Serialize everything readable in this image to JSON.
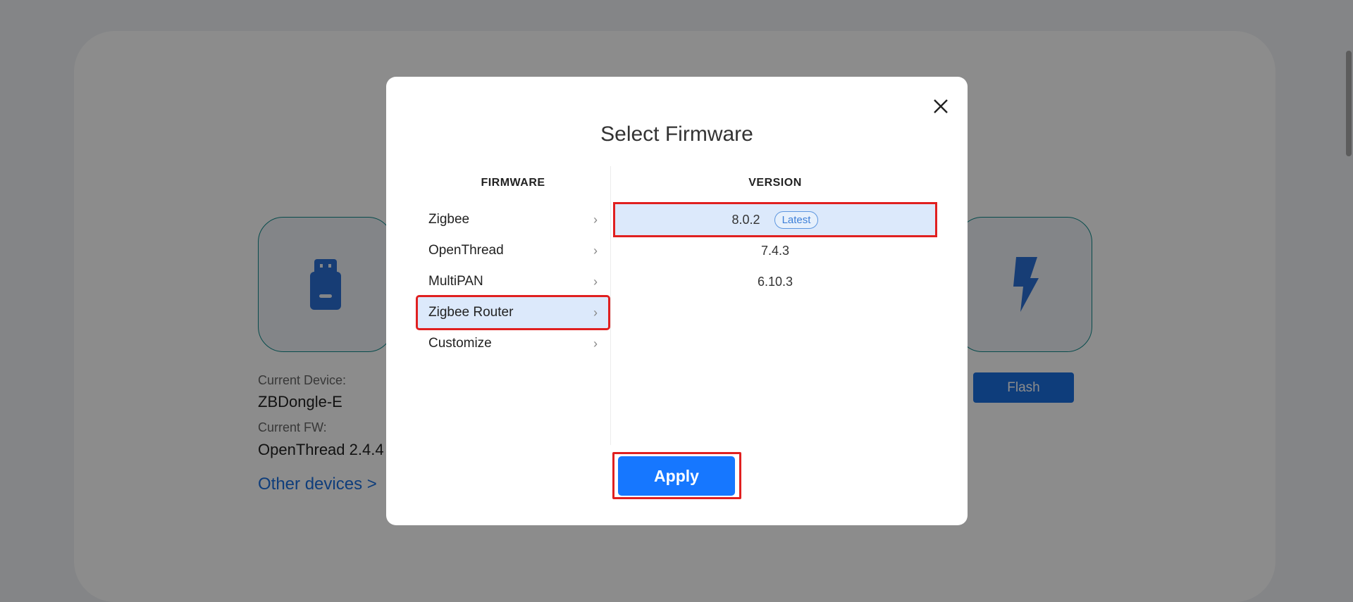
{
  "background": {
    "current_device_label": "Current Device:",
    "current_device_value": "ZBDongle-E",
    "current_fw_label": "Current FW:",
    "current_fw_value": "OpenThread 2.4.4",
    "other_devices_link": "Other devices >",
    "flash_button": "Flash"
  },
  "modal": {
    "title": "Select Firmware",
    "firmware_header": "FIRMWARE",
    "version_header": "VERSION",
    "firmware_items": [
      {
        "label": "Zigbee"
      },
      {
        "label": "OpenThread"
      },
      {
        "label": "MultiPAN"
      },
      {
        "label": "Zigbee Router"
      },
      {
        "label": "Customize"
      }
    ],
    "selected_firmware": "Zigbee Router",
    "versions": [
      {
        "label": "8.0.2",
        "badge": "Latest"
      },
      {
        "label": "7.4.3"
      },
      {
        "label": "6.10.3"
      }
    ],
    "selected_version": "8.0.2",
    "apply_button": "Apply"
  },
  "colors": {
    "accent": "#1677ff",
    "selection_bg": "#dce9fb",
    "highlight_outline": "#e02020",
    "teal_border": "#0d8a8a"
  },
  "icons": {
    "close": "close-icon",
    "chevron": "chevron-right-icon",
    "device": "usb-dongle-icon",
    "flash": "lightning-bolt-icon"
  }
}
